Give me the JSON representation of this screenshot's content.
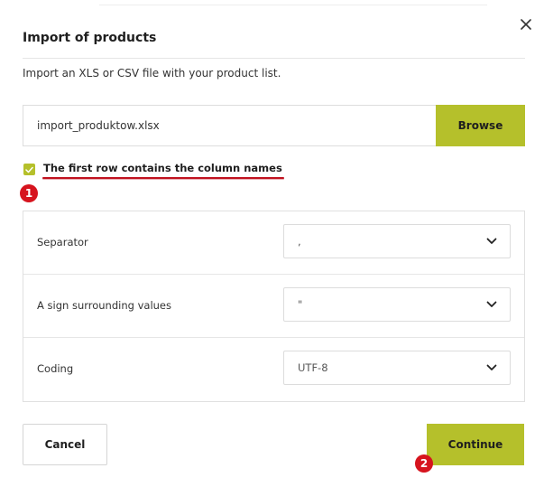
{
  "dialog": {
    "title": "Import of products",
    "intro": "Import an XLS or CSV file with your product list.",
    "close_icon": "close-icon"
  },
  "file": {
    "name": "import_produktow.xlsx",
    "browse_label": "Browse"
  },
  "header_row": {
    "checked": true,
    "label": "The first row contains the column names"
  },
  "settings": [
    {
      "label": "Separator",
      "value": ","
    },
    {
      "label": "A sign surrounding values",
      "value": "\""
    },
    {
      "label": "Coding",
      "value": "UTF-8"
    }
  ],
  "actions": {
    "cancel_label": "Cancel",
    "continue_label": "Continue"
  },
  "annotations": {
    "marker_1": "1",
    "marker_2": "2"
  },
  "colors": {
    "accent": "#b5c02b",
    "annotation_red": "#d6141e"
  }
}
